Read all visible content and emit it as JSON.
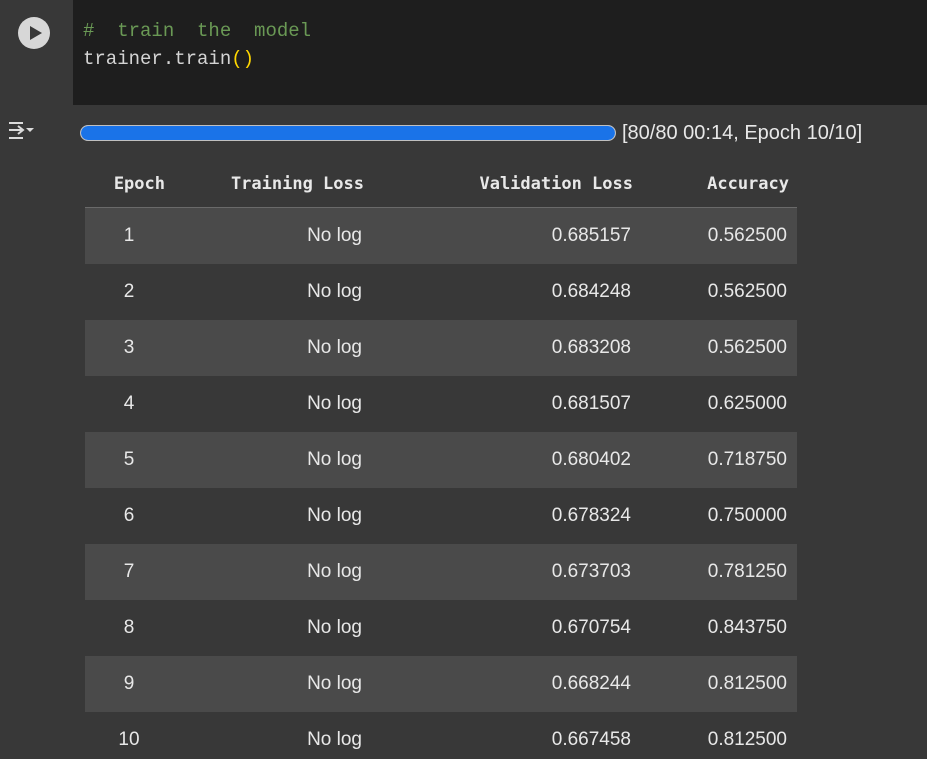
{
  "code": {
    "comment_hash": "#",
    "comment_text": "train  the  model",
    "call_prefix": "trainer.train",
    "call_parens": "()"
  },
  "icons": {
    "run": "play-circle-icon",
    "output_toggle": "output-collapse-icon"
  },
  "progress": {
    "fraction": 1.0,
    "text": "[80/80 00:14, Epoch 10/10]",
    "fill_color": "#1a73e8"
  },
  "table": {
    "headers": [
      "Epoch",
      "Training Loss",
      "Validation Loss",
      "Accuracy"
    ],
    "rows": [
      [
        "1",
        "No log",
        "0.685157",
        "0.562500"
      ],
      [
        "2",
        "No log",
        "0.684248",
        "0.562500"
      ],
      [
        "3",
        "No log",
        "0.683208",
        "0.562500"
      ],
      [
        "4",
        "No log",
        "0.681507",
        "0.625000"
      ],
      [
        "5",
        "No log",
        "0.680402",
        "0.718750"
      ],
      [
        "6",
        "No log",
        "0.678324",
        "0.750000"
      ],
      [
        "7",
        "No log",
        "0.673703",
        "0.781250"
      ],
      [
        "8",
        "No log",
        "0.670754",
        "0.843750"
      ],
      [
        "9",
        "No log",
        "0.668244",
        "0.812500"
      ],
      [
        "10",
        "No log",
        "0.667458",
        "0.812500"
      ]
    ]
  }
}
